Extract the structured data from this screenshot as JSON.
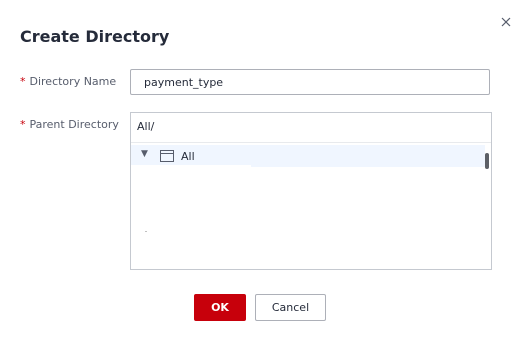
{
  "dialog": {
    "title": "Create Directory",
    "close_icon": "close-icon"
  },
  "form": {
    "directory_name": {
      "required_mark": "*",
      "label": "Directory Name",
      "value": "payment_type"
    },
    "parent_directory": {
      "required_mark": "*",
      "label": "Parent Directory",
      "path": "All/",
      "tree": [
        {
          "label": "All",
          "expanded": true,
          "selected": true,
          "icon": "folder-icon",
          "toggle_icon": "caret-down-icon"
        }
      ]
    }
  },
  "footer": {
    "ok_label": "OK",
    "cancel_label": "Cancel"
  },
  "colors": {
    "primary": "#c7000b",
    "selected_row": "#f0f6ff",
    "text": "#252b3a",
    "label_text": "#575d6c"
  }
}
